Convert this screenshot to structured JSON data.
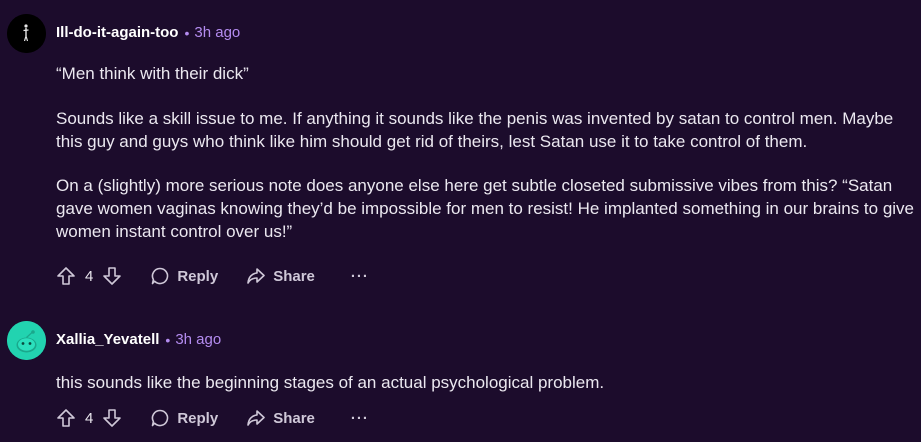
{
  "comments": [
    {
      "author": "Ill-do-it-again-too",
      "dot": "•",
      "time": "3h ago",
      "avatar_icon": "figure-avatar-icon",
      "paragraphs": [
        "“Men think with their dick”",
        "Sounds like a skill issue to me. If anything it sounds like the penis was invented by satan to control men. Maybe this guy and guys who think like him should get rid of theirs, lest Satan use it to take control of them.",
        "On a (slightly) more serious note does anyone else here get subtle closeted submissive vibes from this? “Satan gave women vaginas knowing they’d be impossible for men to resist! He implanted something in our brains to give women instant control over us!”"
      ],
      "votes": "4",
      "reply_label": "Reply",
      "share_label": "Share",
      "more_label": "···"
    },
    {
      "author": "Xallia_Yevatell",
      "dot": "•",
      "time": "3h ago",
      "avatar_icon": "snoo-avatar-icon",
      "paragraphs": [
        "this sounds like the beginning stages of an actual psychological problem."
      ],
      "votes": "4",
      "reply_label": "Reply",
      "share_label": "Share",
      "more_label": "···"
    }
  ],
  "colors": {
    "background": "#1c0c2c",
    "accent_time": "#b48cf0",
    "avatar_teal": "#22d3b0"
  }
}
